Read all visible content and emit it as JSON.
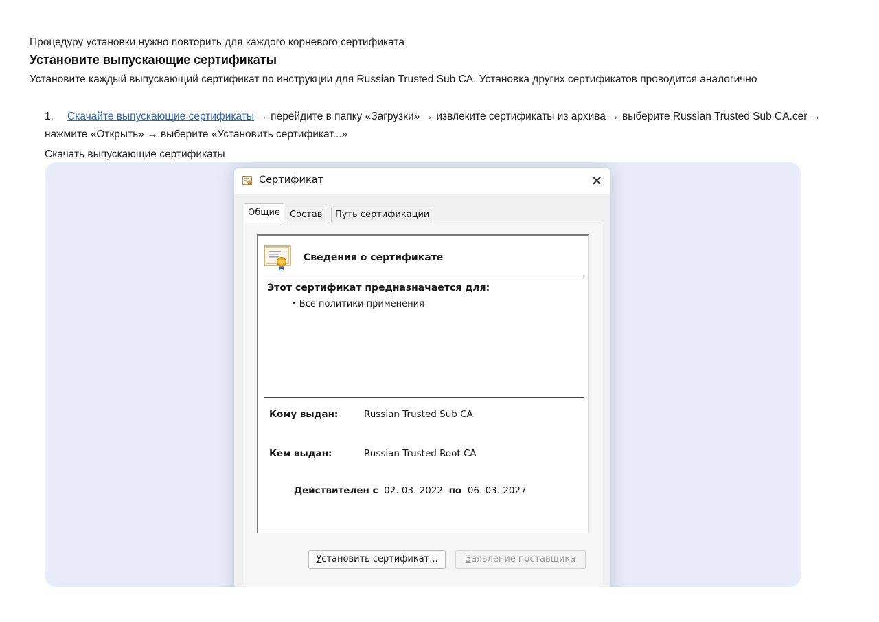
{
  "article": {
    "intro": "Процедуру установки нужно повторить для каждого корневого сертификата",
    "heading": "Установите выпускающие сертификаты",
    "paragraph": "Установите каждый выпускающий сертификат по инструкции для Russian Trusted Sub CA. Установка других сертификатов проводится аналогично",
    "step": {
      "number": "1.",
      "link_text": "Скачайте выпускающие сертификаты",
      "text": " → перейдите в папку «Загрузки» → извлеките сертификаты из архива → выберите Russian Trusted Sub CA.cer → нажмите «Открыть» → выберите «Установить сертификат...»"
    },
    "image_caption": "Скачать выпускающие сертификаты"
  },
  "dialog": {
    "title": "Сертификат",
    "close_glyph": "✕",
    "tabs": [
      {
        "label": "Общие",
        "active": true
      },
      {
        "label": "Состав",
        "active": false
      },
      {
        "label": "Путь сертификации",
        "active": false
      }
    ],
    "info": {
      "heading": "Сведения о сертификате",
      "purpose_title": "Этот сертификат предназначается для:",
      "purpose_items": [
        "• Все политики применения"
      ],
      "issued_to_label": "Кому выдан:",
      "issued_to_value": "Russian Trusted Sub CA",
      "issued_by_label": "Кем выдан:",
      "issued_by_value": "Russian Trusted Root CA",
      "valid_from_label": "Действителен с",
      "valid_from": "02. 03. 2022",
      "valid_to_label": "по",
      "valid_to": "06. 03. 2027"
    },
    "buttons": {
      "install_first_letter": "У",
      "install_rest": "становить сертификат...",
      "issuer_first_letter": "З",
      "issuer_rest": "аявление поставщика"
    }
  },
  "colors": {
    "link": "#2c64c4",
    "frame_background": "#e8ecf8",
    "dialog_background": "#f0f0f0"
  }
}
